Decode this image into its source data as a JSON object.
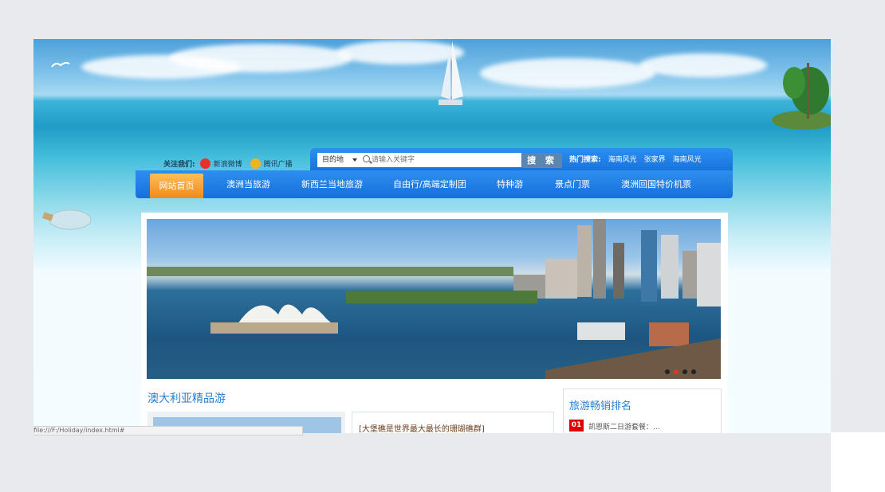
{
  "follow": {
    "label": "关注我们:",
    "weibo": "新浪微博",
    "tencent": "腾讯广播"
  },
  "search": {
    "destination": "目的地",
    "placeholder": "请输入关键字",
    "button": "搜 索",
    "hot_label": "热门搜索:",
    "hot": [
      "海南风光",
      "张家界",
      "海南风光"
    ]
  },
  "nav": {
    "items": [
      "网站首页",
      "澳洲当旅游",
      "新西兰当地旅游",
      "自由行/高端定制团",
      "特种游",
      "景点门票",
      "澳洲回国特价机票"
    ]
  },
  "main": {
    "section_title": "澳大利亚精品游",
    "article_title": "[大堡礁是世界最大最长的珊瑚礁群]"
  },
  "rank": {
    "title": "旅游畅销排名",
    "items": [
      {
        "num": "01",
        "text": "凯恩斯二日游套餐：..."
      }
    ]
  },
  "status_bar": "file:///F:/Holiday/index.html#",
  "colors": {
    "nav_blue": "#1a78e0",
    "active_orange": "#f39a2a",
    "title_blue": "#2a7fd4",
    "rank_red": "#e10000"
  }
}
